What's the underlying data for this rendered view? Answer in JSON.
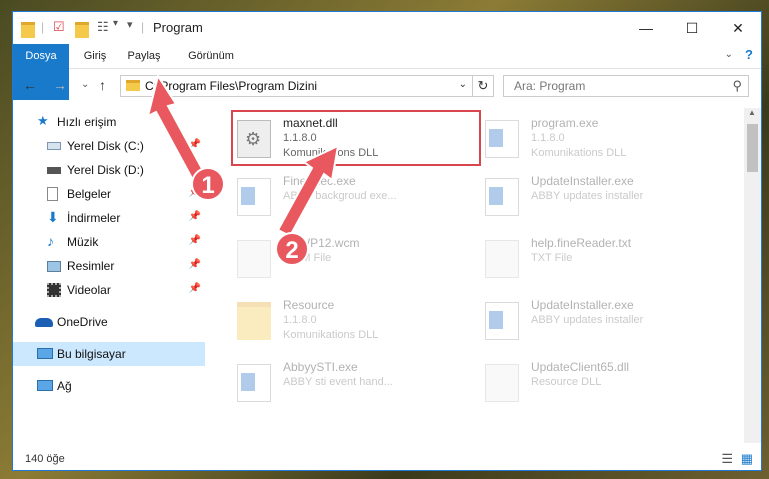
{
  "window": {
    "title": "Program"
  },
  "ribbon": {
    "tabs": [
      {
        "label": "Dosya"
      },
      {
        "label": "Giriş"
      },
      {
        "label": "Paylaş"
      },
      {
        "label": "Görünüm"
      }
    ]
  },
  "address": {
    "path": "C:\\Program Files\\Program Dizini"
  },
  "search": {
    "placeholder": "Ara: Program"
  },
  "sidebar": {
    "items": [
      {
        "label": "Hızlı erişim"
      },
      {
        "label": "Yerel Disk (C:)"
      },
      {
        "label": "Yerel Disk (D:)"
      },
      {
        "label": "Belgeler"
      },
      {
        "label": "İndirmeler"
      },
      {
        "label": "Müzik"
      },
      {
        "label": "Resimler"
      },
      {
        "label": "Videolar"
      },
      {
        "label": "OneDrive"
      },
      {
        "label": "Bu bilgisayar"
      },
      {
        "label": "Ağ"
      }
    ]
  },
  "files": [
    {
      "name": "maxnet.dll",
      "line1": "1.1.8.0",
      "line2": "Komunikations DLL"
    },
    {
      "name": "program.exe",
      "line1": "1.1.8.0",
      "line2": "Komunikations DLL"
    },
    {
      "name": "FineExec.exe",
      "line1": "ABBY backgroud exe...",
      "line2": ""
    },
    {
      "name": "UpdateInstaller.exe",
      "line1": "ABBY updates installer",
      "line2": ""
    },
    {
      "name": "FRWP12.wcm",
      "line1": "WCM File",
      "line2": ""
    },
    {
      "name": "help.fineReader.txt",
      "line1": "TXT File",
      "line2": ""
    },
    {
      "name": "Resource",
      "line1": "1.1.8.0",
      "line2": "Komunikations DLL"
    },
    {
      "name": "UpdateInstaller.exe",
      "line1": "ABBY updates installer",
      "line2": ""
    },
    {
      "name": "AbbyySTI.exe",
      "line1": "ABBY sti event hand...",
      "line2": ""
    },
    {
      "name": "UpdateClient65.dll",
      "line1": "Resource DLL",
      "line2": ""
    }
  ],
  "status": {
    "count": "140 öğe"
  },
  "annotations": {
    "badge1": "1",
    "badge2": "2"
  },
  "colors": {
    "accent": "#1979ca",
    "highlight": "#d9464e",
    "selected": "#cce8ff"
  }
}
